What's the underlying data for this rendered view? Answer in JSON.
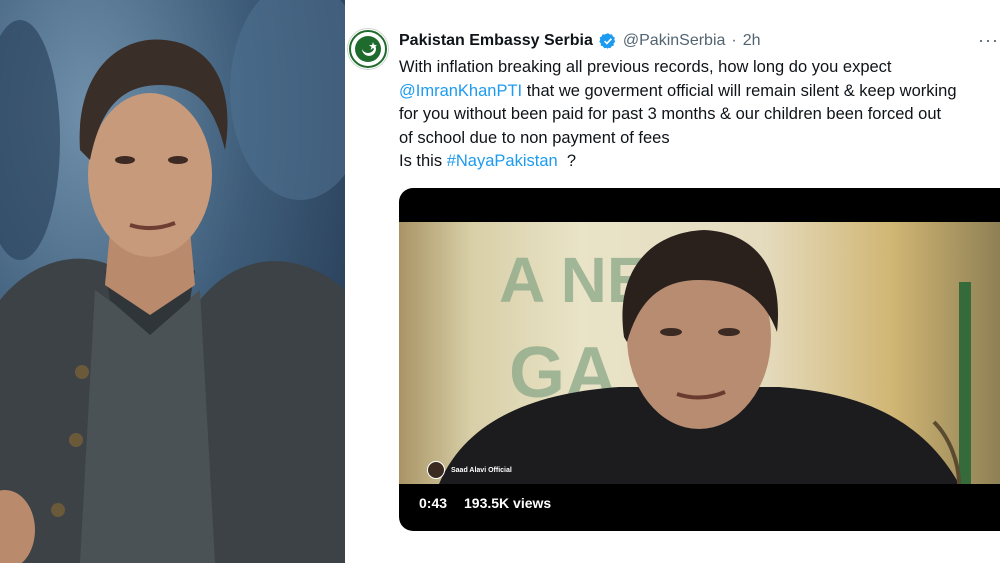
{
  "tweet": {
    "display_name": "Pakistan Embassy Serbia",
    "handle": "@PakinSerbia",
    "separator": "·",
    "time": "2h",
    "more_icon": "···",
    "lines": {
      "l1": "With inflation breaking all previous records, how long do you expect",
      "mention": "@ImranKhanPTI",
      "l2_rest": " that we goverment official will remain silent & keep working",
      "l3": "for you without been paid for past 3 months & our children been forced out",
      "l4": "of school due to non payment of fees",
      "l5_prefix": "Is this ",
      "hashtag": "#NayaPakistan",
      "l5_suffix": "  ?"
    },
    "video": {
      "watermark_text": "Saad Alavi Official",
      "background_text_top": "A  NE",
      "background_text_bottom": "GA  NA",
      "duration": "0:43",
      "views": "193.5K views"
    },
    "colors": {
      "link": "#1d9bf0",
      "verified": "#1d9bf0",
      "muted": "#536471",
      "text": "#0f1419"
    }
  }
}
